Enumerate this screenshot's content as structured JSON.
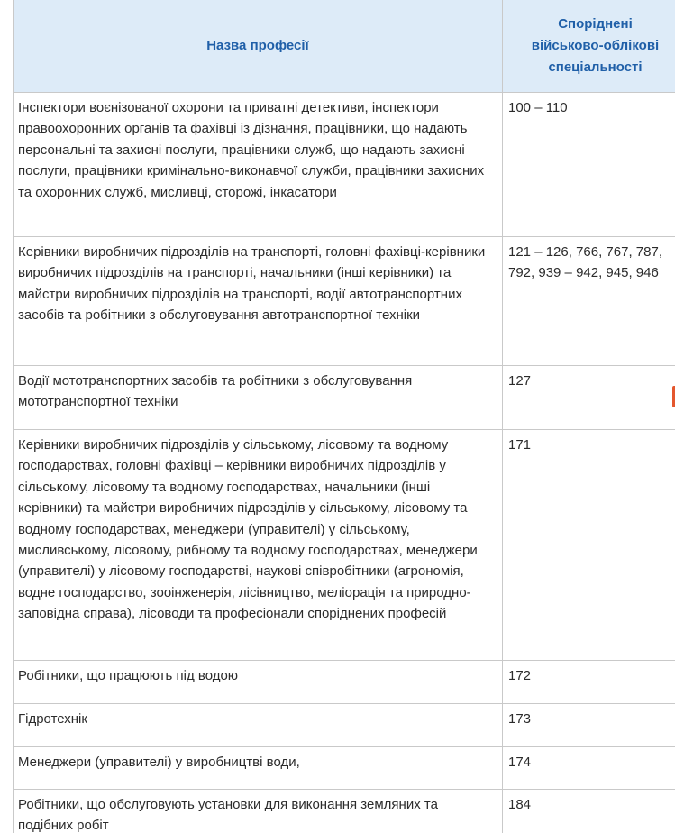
{
  "table": {
    "headers": {
      "profession": "Назва професії",
      "specialty_lines": [
        "Споріднені",
        "військово-облікові",
        "спеціальності"
      ]
    },
    "rows": [
      {
        "profession": "Інспектори воєнізованої охорони та приватні детективи, інспектори правоохоронних органів та фахівці із дізнання, працівники, що надають персональні та захисні послуги, працівники служб, що надають захисні послуги, працівники кримінально-виконавчої служби, працівники захисних та охоронних служб, мисливці, сторожі, інкасатори",
        "codes": "100 – 110"
      },
      {
        "profession": "Керівники виробничих підрозділів на транспорті, головні фахівці-керівники виробничих підрозділів на транспорті, начальники (інші керівники) та майстри виробничих підрозділів на транспорті, водії автотранспортних засобів та робітники з обслуговування автотранспортної техніки",
        "codes": "121 – 126, 766, 767, 787, 792, 939 – 942, 945, 946"
      },
      {
        "profession": "Водії мототранспортних засобів та робітники з обслуговування мототранспортної техніки",
        "codes": "127"
      },
      {
        "profession": "Керівники виробничих підрозділів у сільському, лісовому та водному господарствах, головні фахівці – керівники виробничих підрозділів у сільському, лісовому та водному господарствах, начальники (інші керівники) та майстри виробничих підрозділів у сільському, лісовому та водному господарствах, менеджери (управителі) у сільському, мисливському, лісовому, рибному та водному господарствах, менеджери (управителі) у лісовому господарстві, наукові співробітники (агрономія, водне господарство, зооінженерія, лісівництво, меліорація та природно-заповідна справа), лісоводи та професіонали споріднених професій",
        "codes": "171"
      },
      {
        "profession": "Робітники, що працюють під водою",
        "codes": "172"
      },
      {
        "profession": "Гідротехнік",
        "codes": "173"
      },
      {
        "profession": "Менеджери (управителі) у виробництві води,",
        "codes": "174"
      },
      {
        "profession": "Робітники, що обслуговують установки для виконання земляних та подібних робіт",
        "codes": "184"
      }
    ]
  },
  "colors": {
    "header_bg": "#ddebf8",
    "header_text": "#1f5fa8",
    "border": "#c9c9c9",
    "body_text": "#2b2b2b",
    "edge_mark": "#e4572e"
  }
}
